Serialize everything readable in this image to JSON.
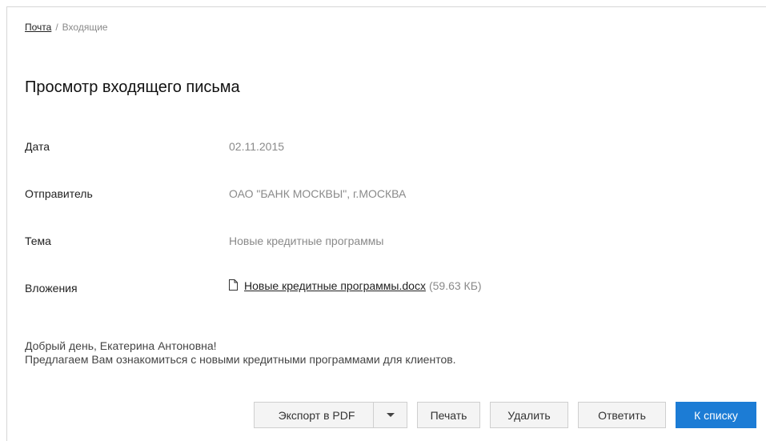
{
  "breadcrumb": {
    "root": "Почта",
    "separator": "/",
    "current": "Входящие"
  },
  "page": {
    "title": "Просмотр входящего письма"
  },
  "fields": {
    "date": {
      "label": "Дата",
      "value": "02.11.2015"
    },
    "sender": {
      "label": "Отправитель",
      "value": "ОАО \"БАНК МОСКВЫ\", г.МОСКВА"
    },
    "subject": {
      "label": "Тема",
      "value": "Новые кредитные программы"
    },
    "attachments": {
      "label": "Вложения",
      "icon": "file-icon",
      "file_name": "Новые кредитные программы.docx",
      "file_size": "(59.63 КБ)"
    }
  },
  "message": {
    "line1": "Добрый день, Екатерина Антоновна!",
    "line2": "Предлагаем Вам ознакомиться с новыми кредитными программами для клиентов."
  },
  "actions": {
    "export_pdf": "Экспорт в PDF",
    "print": "Печать",
    "delete": "Удалить",
    "reply": "Ответить",
    "to_list": "К списку"
  },
  "colors": {
    "primary": "#1c7cd5",
    "muted_text": "#8a8a8a"
  }
}
